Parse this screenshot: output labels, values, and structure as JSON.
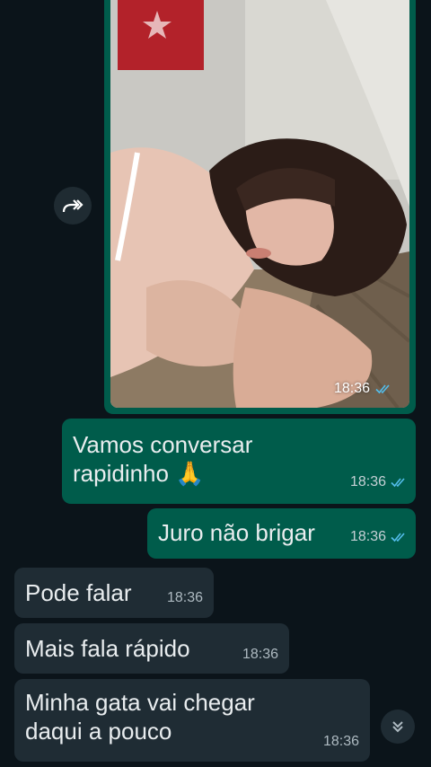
{
  "colors": {
    "background": "#0b141a",
    "outgoing_bubble": "#005c4b",
    "incoming_bubble": "#1f2c34",
    "read_ticks": "#53bdeb"
  },
  "image_message": {
    "time": "18:36",
    "status_icon": "double-check-icon"
  },
  "forward_button": {
    "icon": "forward-icon"
  },
  "messages": [
    {
      "direction": "out",
      "text": "Vamos conversar\nrapidinho 🙏",
      "time": "18:36",
      "status_icon": "double-check-icon"
    },
    {
      "direction": "out",
      "text": "Juro não brigar",
      "time": "18:36",
      "status_icon": "double-check-icon"
    },
    {
      "direction": "in",
      "text": "Pode falar",
      "time": "18:36"
    },
    {
      "direction": "in",
      "text": "Mais fala rápido",
      "time": "18:36"
    },
    {
      "direction": "in",
      "text": "Minha gata vai chegar\ndaqui a pouco",
      "time": "18:36"
    }
  ],
  "scroll_button": {
    "icon": "double-chevron-down-icon"
  }
}
